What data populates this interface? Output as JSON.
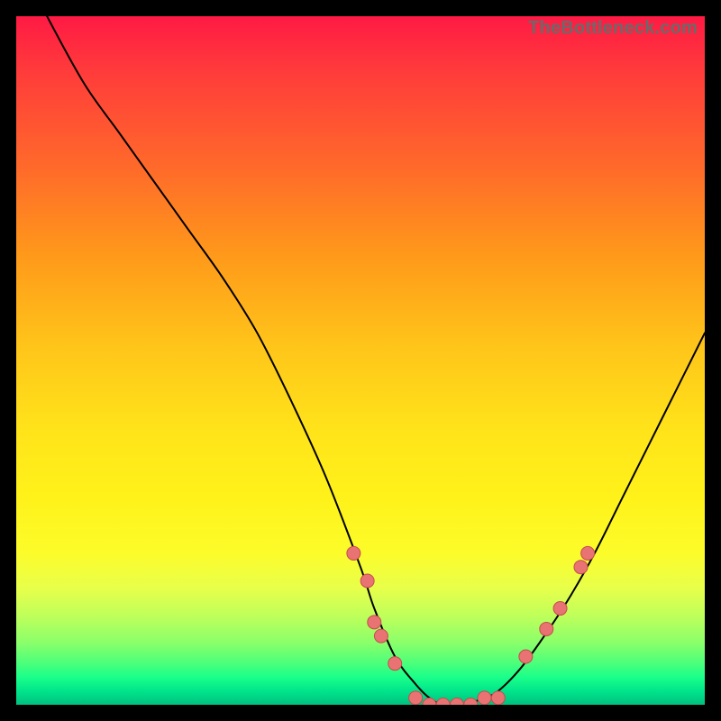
{
  "watermark": "TheBottleneck.com",
  "colors": {
    "background": "#000000",
    "watermark": "#6a6a6a",
    "curve": "#000000",
    "dot_fill": "#e97272",
    "dot_stroke": "#c44d4d",
    "gradient_top": "#ff1a44",
    "gradient_bottom": "#00c080"
  },
  "chart_data": {
    "type": "line",
    "title": "",
    "xlabel": "",
    "ylabel": "",
    "xlim": [
      0,
      100
    ],
    "ylim": [
      0,
      100
    ],
    "grid": false,
    "legend": false,
    "annotations": [
      "TheBottleneck.com"
    ],
    "series": [
      {
        "name": "curve",
        "x": [
          0,
          2,
          5,
          10,
          15,
          20,
          25,
          30,
          35,
          40,
          45,
          50,
          52,
          55,
          58,
          60,
          62,
          65,
          68,
          70,
          73,
          76,
          80,
          84,
          88,
          92,
          96,
          100
        ],
        "y": [
          110,
          105,
          99,
          90,
          83,
          76,
          69,
          62,
          54,
          44,
          33,
          20,
          14,
          7,
          3,
          1,
          0,
          0,
          1,
          2,
          5,
          9,
          15,
          22,
          30,
          38,
          46,
          54
        ]
      }
    ],
    "dots": [
      {
        "name": "p1",
        "x": 49,
        "y": 22
      },
      {
        "name": "p2",
        "x": 51,
        "y": 18
      },
      {
        "name": "p3",
        "x": 52,
        "y": 12
      },
      {
        "name": "p4",
        "x": 53,
        "y": 10
      },
      {
        "name": "p5",
        "x": 55,
        "y": 6
      },
      {
        "name": "p6",
        "x": 58,
        "y": 1
      },
      {
        "name": "p7",
        "x": 60,
        "y": 0
      },
      {
        "name": "p8",
        "x": 62,
        "y": 0
      },
      {
        "name": "p9",
        "x": 64,
        "y": 0
      },
      {
        "name": "p10",
        "x": 66,
        "y": 0
      },
      {
        "name": "p11",
        "x": 68,
        "y": 1
      },
      {
        "name": "p12",
        "x": 70,
        "y": 1
      },
      {
        "name": "p13",
        "x": 74,
        "y": 7
      },
      {
        "name": "p14",
        "x": 77,
        "y": 11
      },
      {
        "name": "p15",
        "x": 79,
        "y": 14
      },
      {
        "name": "p16",
        "x": 82,
        "y": 20
      },
      {
        "name": "p17",
        "x": 83,
        "y": 22
      }
    ]
  }
}
